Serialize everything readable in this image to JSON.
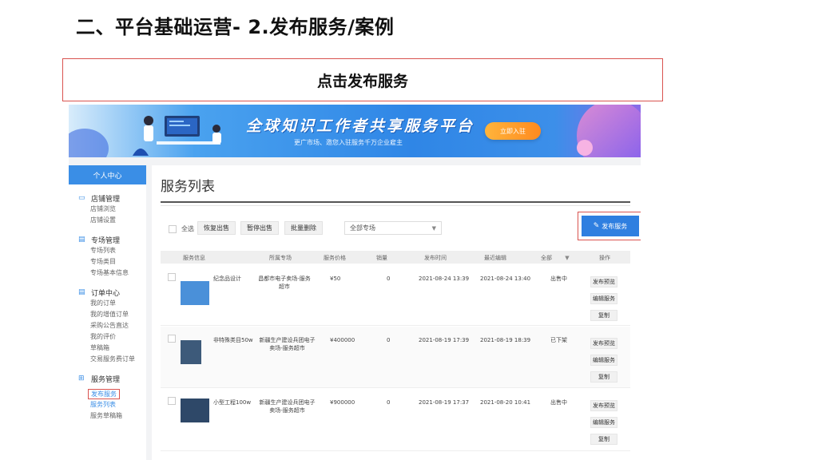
{
  "slide": {
    "title": "二、平台基础运营- 2.发布服务/案例",
    "callout": "点击发布服务"
  },
  "banner": {
    "title": "全球知识工作者共享服务平台",
    "subtitle": "更广市场、邀您入驻服务千万企业雇主",
    "cta": "立即入驻"
  },
  "sidebar": {
    "header": "个人中心",
    "groups": [
      {
        "icon": "store-icon",
        "title": "店铺管理",
        "items": [
          "店铺浏览",
          "店铺设置"
        ]
      },
      {
        "icon": "document-icon",
        "title": "专场管理",
        "items": [
          "专场列表",
          "专场类目",
          "专场基本信息"
        ]
      },
      {
        "icon": "document-icon",
        "title": "订单中心",
        "items": [
          "我的订单",
          "我的增值订单",
          "采购公告直达",
          "我的评价",
          "草稿箱",
          "交易服务费订单"
        ]
      },
      {
        "icon": "grid-icon",
        "title": "服务管理",
        "items": [
          "发布服务",
          "服务列表",
          "服务草稿箱"
        ]
      }
    ]
  },
  "main": {
    "title": "服务列表",
    "toolbar": {
      "select_all": "全选",
      "buttons": [
        "恢复出售",
        "暂停出售",
        "批量删除"
      ],
      "market_select": "全部专场",
      "publish": "发布服务"
    },
    "columns": [
      "服务信息",
      "所属专场",
      "服务价格",
      "销量",
      "发布时间",
      "最近编辑",
      "全部",
      "操作"
    ],
    "rows": [
      {
        "name": "纪念品设计",
        "market": "昌都市电子卖场-服务超市",
        "price": "¥50",
        "sales": "0",
        "published": "2021-08-24 13:39",
        "edited": "2021-08-24 13:40",
        "status": "出售中",
        "thumb_color": "#4a90d9",
        "actions": [
          "发布预览",
          "编辑服务",
          "复制"
        ]
      },
      {
        "name": "非特殊类目50w",
        "market": "新疆生产建设兵团电子卖场-服务超市",
        "price": "¥400000",
        "sales": "0",
        "published": "2021-08-19 17:39",
        "edited": "2021-08-19 18:39",
        "status": "已下架",
        "thumb_color": "#3d5a7a",
        "actions": [
          "发布预览",
          "编辑服务",
          "复制"
        ]
      },
      {
        "name": "小型工程100w",
        "market": "新疆生产建设兵团电子卖场-服务超市",
        "price": "¥900000",
        "sales": "0",
        "published": "2021-08-19 17:37",
        "edited": "2021-08-20 10:41",
        "status": "出售中",
        "thumb_color": "#2e4868",
        "actions": [
          "发布预览",
          "编辑服务",
          "复制"
        ]
      }
    ]
  }
}
